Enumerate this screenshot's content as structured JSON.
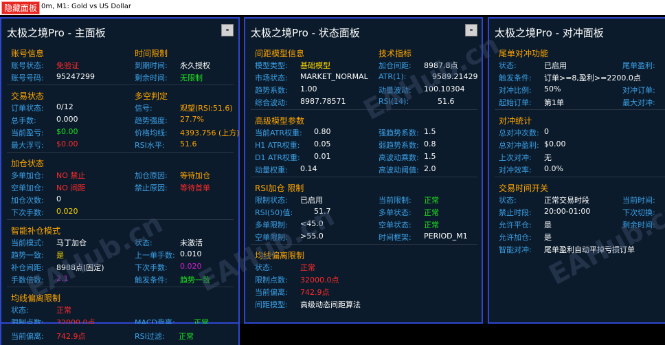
{
  "topbar": {
    "hide_label": "隐藏面板",
    "symbol": "0m, M1:  Gold vs US Dollar"
  },
  "left": {
    "title": "太极之境Pro - 主面板",
    "account": {
      "head": "账号信息",
      "status_l": "账号状态:",
      "status_v": "免验证",
      "num_l": "账号号码:",
      "num_v": "95247299"
    },
    "time": {
      "head": "时间限制",
      "exp_l": "到期时间:",
      "exp_v": "永久授权",
      "rem_l": "剩余时间:",
      "rem_v": "无限制"
    },
    "trade": {
      "head": "交易状态",
      "orders_l": "订单状态:",
      "orders_v": "0/12",
      "lots_l": "总手数:",
      "lots_v": "0.000",
      "profit_l": "当前盈亏:",
      "profit_v": "$0.00",
      "float_l": "最大浮亏:",
      "float_v": "$0.00"
    },
    "trend": {
      "head": "多空判定",
      "sig_l": "信号:",
      "sig_v": "观望(RSI:51.6)",
      "str_l": "趋势强度:",
      "str_v": "27.7%",
      "ma_l": "价格均线:",
      "ma_v": "4393.756 (上方)",
      "rsi_l": "RSI水平:",
      "rsi_v": "51.6"
    },
    "add": {
      "head": "加仓状态",
      "long_l": "多单加仓:",
      "long_v": "NO 禁止",
      "short_l": "空单加仓:",
      "short_v": "NO 间距",
      "cnt_l": "加仓次数:",
      "cnt_v": "0",
      "next_l": "下次手数:",
      "next_v": "0.020",
      "reason_l": "加仓原因:",
      "reason_v": "等待加仓",
      "ban_l": "禁止原因:",
      "ban_v": "等待首单"
    },
    "smart": {
      "head": "智能补仓模式",
      "mode_l": "当前模式:",
      "mode_v": "马丁加仓",
      "trend_l": "趋势一致:",
      "trend_v": "是",
      "pts_l": "补仓间距:",
      "pts_v": "8988点(固定)",
      "mult_l": "手数倍数:",
      "mult_v": "2.1",
      "state_l": "状态:",
      "state_v": "未激活",
      "last_l": "上一单手数:",
      "last_v": "0.010",
      "nxt_l": "下次手数:",
      "nxt_v": "0.020",
      "trig_l": "触发条件:",
      "trig_v": "趋势一致"
    },
    "ma": {
      "head": "均线偏离限制",
      "state_l": "状态:",
      "state_v": "正常",
      "limit_l": "限制点数:",
      "limit_v": "32000.0点",
      "cur_l": "当前偏离:",
      "cur_v": "742.9点",
      "macd_l": "MACD背离:",
      "macd_v": "正常",
      "rsi_l": "RSI过滤:",
      "rsi_v": "正常"
    }
  },
  "mid": {
    "title": "太极之境Pro - 状态面板",
    "grid": {
      "head": "间距模型信息",
      "type_l": "模型类型:",
      "type_v": "基础模型",
      "mkt_l": "市场状态:",
      "mkt_v": "MARKET_NORMAL",
      "trend_l": "趋势系数:",
      "trend_v": "1.00",
      "wave_l": "综合波动:",
      "wave_v": "8987.78571"
    },
    "tech": {
      "head": "技术指标",
      "pts_l": "加仓间距:",
      "pts_v": "8987.8点",
      "atr_l": "ATR(1):",
      "atr_v": "9589.21429",
      "mom_l": "动量波动:",
      "mom_v": "100.10304",
      "rsi_l": "RSI(14):",
      "rsi_v": "51.6"
    },
    "adv": {
      "head": "高级模型参数",
      "a_l": "当前ATR权重:",
      "a_v": "0.80",
      "h1_l": "H1 ATR权重:",
      "h1_v": "0.05",
      "d1_l": "D1 ATR权重:",
      "d1_v": "0.01",
      "mw_l": "动量权重:",
      "mw_v": "0.14",
      "st_l": "强趋势系数:",
      "st_v": "1.5",
      "wk_l": "弱趋势系数:",
      "wk_v": "0.8",
      "hv_l": "高波动乘数:",
      "hv_v": "1.5",
      "ht_l": "高波动阈值:",
      "ht_v": "2.0"
    },
    "rsi": {
      "head": "RSI加仓 限制",
      "st_l": "限制状态:",
      "st_v": "已启用",
      "r50_l": "RSI(50)值:",
      "r50_v": "51.7",
      "lg_l": "多单限制:",
      "lg_v": "<45.0",
      "sh_l": "空单限制:",
      "sh_v": ">55.0",
      "cur_l": "当前限制:",
      "cur_v": "正常",
      "ls_l": "多单状态:",
      "ls_v": "正常",
      "ss_l": "空单状态:",
      "ss_v": "正常",
      "tf_l": "时间框架:",
      "tf_v": "PERIOD_M1"
    },
    "ma": {
      "head": "均线偏离限制",
      "st_l": "状态:",
      "st_v": "正常",
      "lim_l": "限制点数:",
      "lim_v": "32000.0点",
      "cur_l": "当前偏离:",
      "cur_v": "742.9点",
      "md_l": "间距模型:",
      "md_v": "高级动态间距算法"
    }
  },
  "right": {
    "title": "太极之境Pro - 对冲面板",
    "hedge": {
      "head": "尾单对冲功能",
      "st_l": "状态:",
      "st_v": "已启用",
      "tr_l": "触发条件:",
      "tr_v": "订单>=8,盈利>=2200.0点",
      "ratio_l": "对冲比例:",
      "ratio_v": "50%",
      "start_l": "起始订单:",
      "start_v": "第1单",
      "c1": "尾单盈利:",
      "c2": "对冲订单:",
      "c3": "最大对冲:"
    },
    "stat": {
      "head": "对冲统计",
      "cnt_l": "总对冲次数:",
      "cnt_v": "0",
      "pf_l": "总对冲盈利:",
      "pf_v": "$0.00",
      "last_l": "上次对冲:",
      "last_v": "无",
      "eff_l": "对冲效率:",
      "eff_v": "0.0%"
    },
    "time": {
      "head": "交易时间开关",
      "st_l": "状态:",
      "st_v": "正常交易时段",
      "ban_l": "禁止时段:",
      "ban_v": "20:00-01:00",
      "cl_l": "允许平仓:",
      "cl_v": "是",
      "ad_l": "允许加仓:",
      "ad_v": "是",
      "sm_l": "智能对冲:",
      "sm_v": "尾单盈利自动平掉亏损订单",
      "c1": "当前时间:",
      "c2": "下次切换:",
      "c3": "剩余时间:"
    }
  },
  "watermark": "EAHub.cn"
}
